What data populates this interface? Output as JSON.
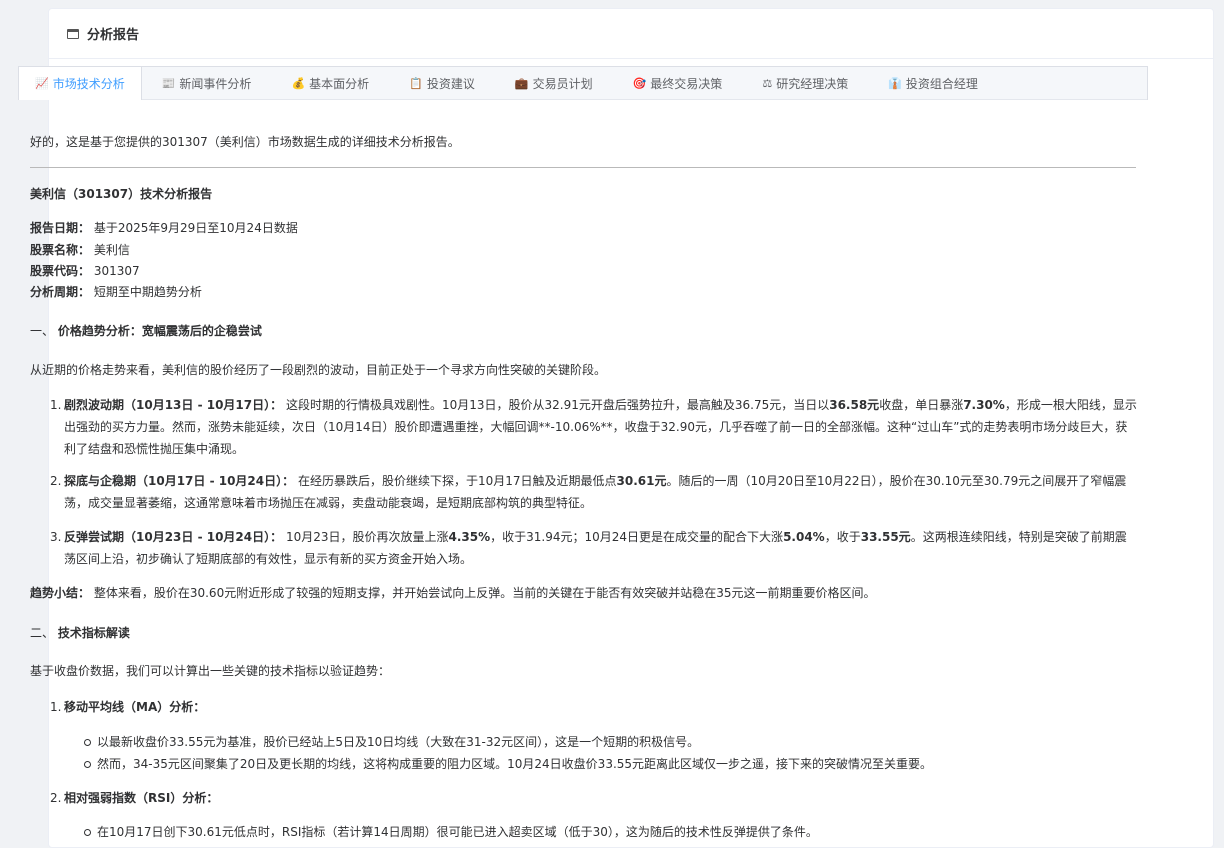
{
  "header": {
    "title": "分析报告"
  },
  "tabs": [
    {
      "label": "市场技术分析",
      "icon": "📈",
      "active": true
    },
    {
      "label": "新闻事件分析",
      "icon": "📰",
      "active": false
    },
    {
      "label": "基本面分析",
      "icon": "💰",
      "active": false
    },
    {
      "label": "投资建议",
      "icon": "📋",
      "active": false
    },
    {
      "label": "交易员计划",
      "icon": "💼",
      "active": false
    },
    {
      "label": "最终交易决策",
      "icon": "🎯",
      "active": false
    },
    {
      "label": "研究经理决策",
      "icon": "⚖",
      "active": false
    },
    {
      "label": "投资组合经理",
      "icon": "👔",
      "active": false
    }
  ],
  "report": {
    "intro": "好的，这是基于您提供的301307（美利信）市场数据生成的详细技术分析报告。",
    "title": "美利信（301307）技术分析报告",
    "meta": [
      {
        "label": "报告日期：",
        "value": "基于2025年9月29日至10月24日数据"
      },
      {
        "label": "股票名称：",
        "value": "美利信"
      },
      {
        "label": "股票代码：",
        "value": "301307"
      },
      {
        "label": "分析周期：",
        "value": "短期至中期趋势分析"
      }
    ],
    "section1": {
      "heading_prefix": "一、",
      "heading": "价格趋势分析：宽幅震荡后的企稳尝试",
      "lead": "从近期的价格走势来看，美利信的股价经历了一段剧烈的波动，目前正处于一个寻求方向性突破的关键阶段。",
      "items": [
        {
          "num": "1.",
          "title": "剧烈波动期（10月13日 - 10月17日）：",
          "t1": "这段时期的行情极具戏剧性。10月13日，股价从32.91元开盘后强势拉升，最高触及36.75元，当日以",
          "b1": "36.58元",
          "t2": "收盘，单日暴涨",
          "b2": "7.30%",
          "t3": "，形成一根大阳线，显示出强劲的买方力量。然而，涨势未能延续，次日（10月14日）股价即遭遇重挫，大幅回调**-10.06%**，收盘于32.90元，几乎吞噬了前一日的全部涨幅。这种“过山车”式的走势表明市场分歧巨大，获利了结盘和恐慌性抛压集中涌现。"
        },
        {
          "num": "2.",
          "title": "探底与企稳期（10月17日 - 10月24日）：",
          "t1": "在经历暴跌后，股价继续下探，于10月17日触及近期最低点",
          "b1": "30.61元",
          "t2": "。随后的一周（10月20日至10月22日），股价在30.10元至30.79元之间展开了窄幅震荡，成交量显著萎缩，这通常意味着市场抛压在减弱，卖盘动能衰竭，是短期底部构筑的典型特征。"
        },
        {
          "num": "3.",
          "title": "反弹尝试期（10月23日 - 10月24日）：",
          "t1": "10月23日，股价再次放量上涨",
          "b1": "4.35%",
          "t2": "，收于31.94元；10月24日更是在成交量的配合下大涨",
          "b2": "5.04%",
          "t3": "，收于",
          "b3": "33.55元",
          "t4": "。这两根连续阳线，特别是突破了前期震荡区间上沿，初步确认了短期底部的有效性，显示有新的买方资金开始入场。"
        }
      ],
      "summary_label": "趋势小结：",
      "summary": "整体来看，股价在30.60元附近形成了较强的短期支撑，并开始尝试向上反弹。当前的关键在于能否有效突破并站稳在35元这一前期重要价格区间。"
    },
    "section2": {
      "heading_prefix": "二、",
      "heading": "技术指标解读",
      "lead": "基于收盘价数据，我们可以计算出一些关键的技术指标以验证趋势：",
      "ma_num": "1.",
      "ma_title": "移动平均线（MA）分析：",
      "ma_bullets": [
        "以最新收盘价33.55元为基准，股价已经站上5日及10日均线（大致在31-32元区间），这是一个短期的积极信号。",
        "然而，34-35元区间聚集了20日及更长期的均线，这将构成重要的阻力区域。10月24日收盘价33.55元距离此区域仅一步之遥，接下来的突破情况至关重要。"
      ],
      "rsi_num": "2.",
      "rsi_title": "相对强弱指数（RSI）分析：",
      "rsi_bullets": [
        "在10月17日创下30.61元低点时，RSI指标（若计算14日周期）很可能已进入超卖区域（低于30），这为随后的技术性反弹提供了条件。"
      ]
    }
  }
}
